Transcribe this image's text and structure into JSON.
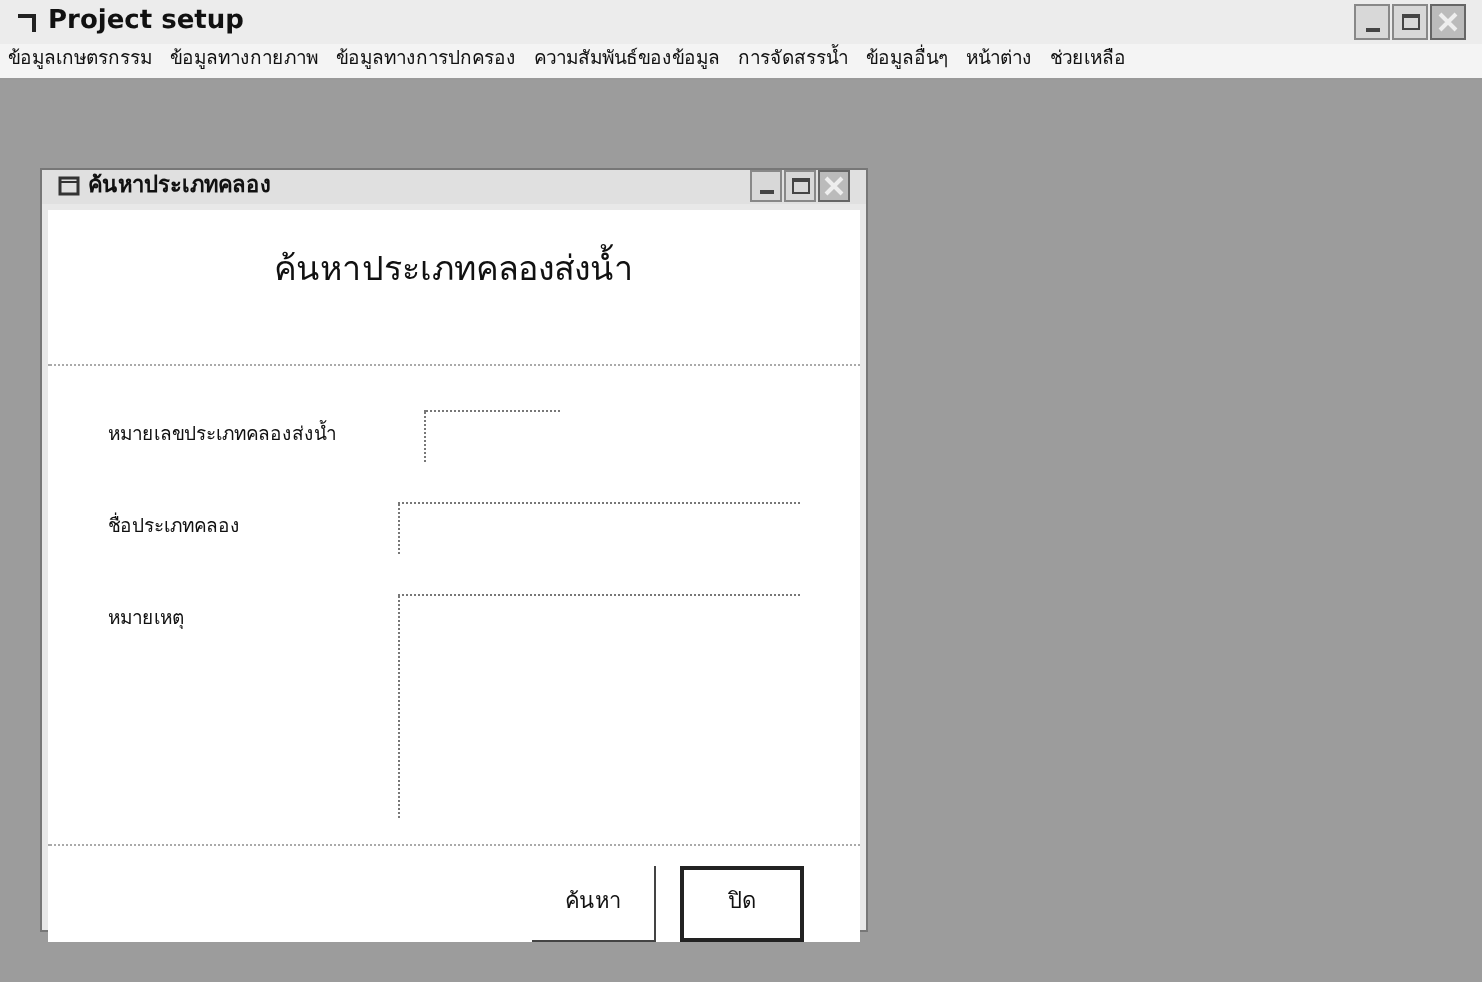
{
  "window": {
    "title": "Project setup"
  },
  "menu": [
    "ข้อมูลเกษตรกรรม",
    "ข้อมูลทางกายภาพ",
    "ข้อมูลทางการปกครอง",
    "ความสัมพันธ์ของข้อมูล",
    "การจัดสรรน้ำ",
    "ข้อมูลอื่นๆ",
    "หน้าต่าง",
    "ช่วยเหลือ"
  ],
  "dialog": {
    "title": "ค้นหาประเภทคลอง",
    "heading": "ค้นหาประเภทคลองส่งน้ำ",
    "fields": [
      {
        "label": "หมายเลขประเภทคลองส่งน้ำ",
        "kind": "short"
      },
      {
        "label": "ชื่อประเภทคลอง",
        "kind": "wide"
      },
      {
        "label": "หมายเหตุ",
        "kind": "multiline"
      }
    ],
    "buttons": [
      {
        "label": "ค้นหา",
        "selected": false
      },
      {
        "label": "ปิด",
        "selected": true
      }
    ]
  }
}
